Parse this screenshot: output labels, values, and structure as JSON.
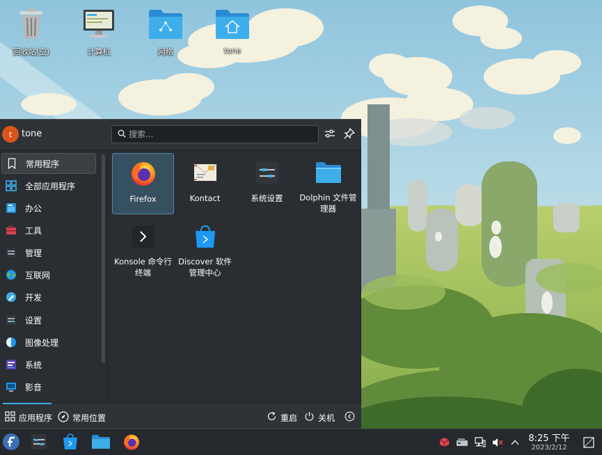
{
  "desktop": {
    "icons": [
      {
        "label": "回收站(空)",
        "icon": "trash-icon"
      },
      {
        "label": "计算机",
        "icon": "computer-icon"
      },
      {
        "label": "网络",
        "icon": "network-folder-icon"
      },
      {
        "label": "tone",
        "icon": "home-folder-icon"
      }
    ]
  },
  "launcher": {
    "user": {
      "initial": "t",
      "name": "tone"
    },
    "search": {
      "placeholder": "搜索...",
      "value": ""
    },
    "categories": [
      {
        "label": "常用程序",
        "icon": "bookmark-icon"
      },
      {
        "label": "全部应用程序",
        "icon": "all-apps-icon"
      },
      {
        "label": "办公",
        "icon": "office-icon"
      },
      {
        "label": "工具",
        "icon": "toolbox-icon"
      },
      {
        "label": "管理",
        "icon": "system-admin-icon"
      },
      {
        "label": "互联网",
        "icon": "globe-icon"
      },
      {
        "label": "开发",
        "icon": "development-icon"
      },
      {
        "label": "设置",
        "icon": "settings-icon"
      },
      {
        "label": "图像处理",
        "icon": "graphics-icon"
      },
      {
        "label": "系统",
        "icon": "system-icon"
      },
      {
        "label": "影音",
        "icon": "multimedia-icon"
      }
    ],
    "apps": [
      {
        "label": "Firefox",
        "icon": "firefox-icon"
      },
      {
        "label": "Kontact",
        "icon": "kontact-icon"
      },
      {
        "label": "系统设置",
        "icon": "system-settings-icon"
      },
      {
        "label": "Dolphin 文件管理器",
        "icon": "dolphin-folder-icon"
      },
      {
        "label": "Konsole 命令行终端",
        "icon": "konsole-icon"
      },
      {
        "label": "Discover 软件管理中心",
        "icon": "discover-icon"
      }
    ],
    "footer": {
      "applications": "应用程序",
      "places": "常用位置",
      "restart": "重启",
      "shutdown": "关机"
    }
  },
  "taskbar": {
    "apps": [
      "fedora-launcher-icon",
      "system-settings-icon",
      "discover-icon",
      "dolphin-icon",
      "firefox-icon"
    ],
    "tray": [
      "package-updates-icon",
      "device-icon",
      "network-icon",
      "volume-muted-icon",
      "chevron-up-icon"
    ],
    "clock": {
      "time": "8:25 下午",
      "date": "2023/2/12"
    }
  },
  "colors": {
    "accent": "#3daee9",
    "panel": "#2a2e32",
    "taskbar": "#25282c"
  }
}
